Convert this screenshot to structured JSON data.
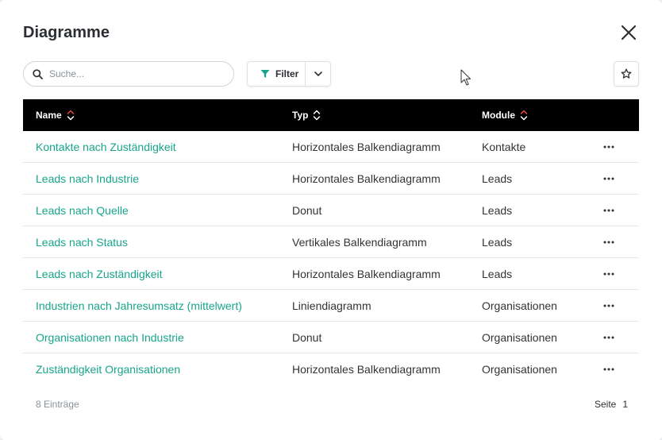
{
  "dialog": {
    "title": "Diagramme"
  },
  "search": {
    "placeholder": "Suche...",
    "value": ""
  },
  "toolbar": {
    "filter_label": "Filter"
  },
  "colors": {
    "accent": "#17a589",
    "header_bg": "#000000",
    "sort_active": "#e74c3c"
  },
  "table": {
    "columns": [
      {
        "label": "Name",
        "sort": "active"
      },
      {
        "label": "Typ",
        "sort": "neutral"
      },
      {
        "label": "Module",
        "sort": "active"
      }
    ],
    "rows": [
      {
        "name": "Kontakte nach Zuständigkeit",
        "type": "Horizontales Balkendiagramm",
        "module": "Kontakte"
      },
      {
        "name": "Leads nach Industrie",
        "type": "Horizontales Balkendiagramm",
        "module": "Leads"
      },
      {
        "name": "Leads nach Quelle",
        "type": "Donut",
        "module": "Leads"
      },
      {
        "name": "Leads nach Status",
        "type": "Vertikales Balkendiagramm",
        "module": "Leads"
      },
      {
        "name": "Leads nach Zuständigkeit",
        "type": "Horizontales Balkendiagramm",
        "module": "Leads"
      },
      {
        "name": "Industrien nach Jahresumsatz (mittelwert)",
        "type": "Liniendiagramm",
        "module": "Organisationen"
      },
      {
        "name": "Organisationen nach Industrie",
        "type": "Donut",
        "module": "Organisationen"
      },
      {
        "name": "Zuständigkeit Organisationen",
        "type": "Horizontales Balkendiagramm",
        "module": "Organisationen"
      }
    ]
  },
  "footer": {
    "count": "8 Einträge",
    "page_label": "Seite",
    "page_number": "1"
  }
}
